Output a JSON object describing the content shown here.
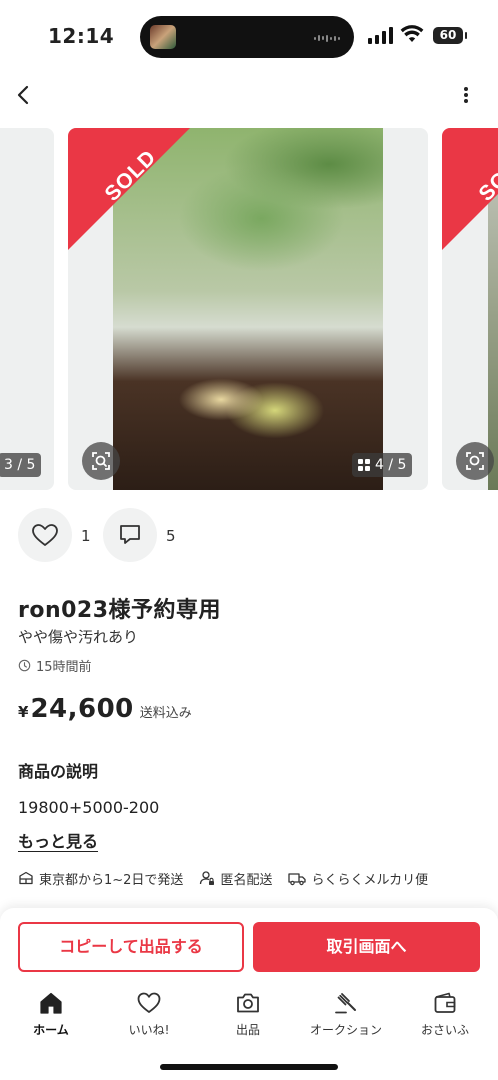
{
  "status_bar": {
    "time": "12:14",
    "battery": "60"
  },
  "carousel": {
    "sold_label": "SOLD",
    "prev_counter": "3 / 5",
    "current_counter": "4 / 5"
  },
  "actions": {
    "likes": "1",
    "comments": "5"
  },
  "item": {
    "title": "ron023様予約専用",
    "condition": "やや傷や汚れあり",
    "posted": "15時間前",
    "currency": "¥",
    "price": "24,600",
    "shipping_included": "送料込み"
  },
  "description": {
    "heading": "商品の説明",
    "body": "19800+5000-200",
    "more_link": "もっと見る"
  },
  "shipping": {
    "origin": "東京都から1~2日で発送",
    "anonymous": "匿名配送",
    "method": "らくらくメルカリ便"
  },
  "buttons": {
    "copy": "コピーして出品する",
    "deal": "取引画面へ"
  },
  "tabbar": [
    {
      "label": "ホーム",
      "icon": "home-icon"
    },
    {
      "label": "いいね!",
      "icon": "heart-icon"
    },
    {
      "label": "出品",
      "icon": "camera-icon"
    },
    {
      "label": "オークション",
      "icon": "gavel-icon"
    },
    {
      "label": "おさいふ",
      "icon": "wallet-icon"
    }
  ],
  "colors": {
    "accent": "#ea3745",
    "text": "#222222"
  }
}
